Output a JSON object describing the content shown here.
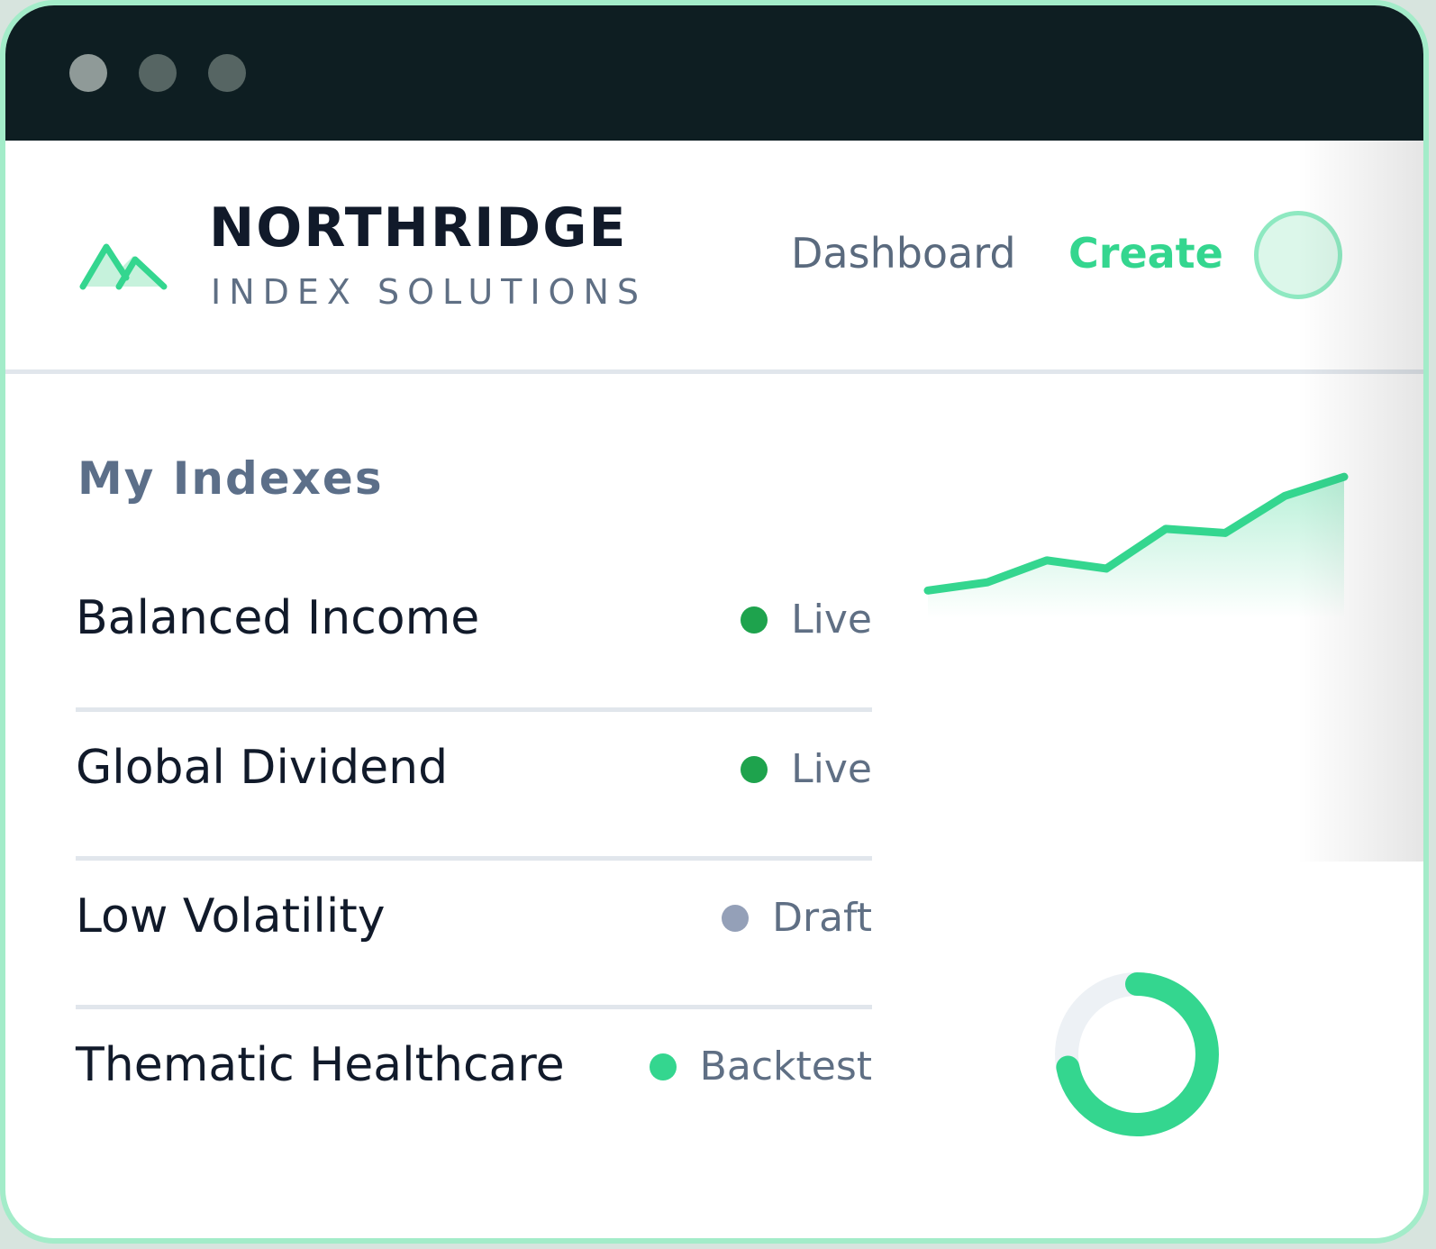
{
  "window": {
    "controls": [
      "close",
      "minimize",
      "maximize"
    ]
  },
  "header": {
    "brand_name": "NORTHRIDGE",
    "brand_subtitle": "INDEX SOLUTIONS",
    "logo_icon": "mountain-icon",
    "nav": {
      "dashboard": "Dashboard",
      "create": "Create"
    },
    "accent_color": "#34d68f"
  },
  "main": {
    "section_title": "My Indexes",
    "indexes": [
      {
        "name": "Balanced Income",
        "status": "Live",
        "status_color": "#1ea34d"
      },
      {
        "name": "Global Dividend",
        "status": "Live",
        "status_color": "#1ea34d"
      },
      {
        "name": "Low Volatility",
        "status": "Draft",
        "status_color": "#94a0b8"
      },
      {
        "name": "Thematic Healthcare",
        "status": "Backtest",
        "status_color": "#34d68f"
      }
    ]
  },
  "chart_data": [
    {
      "type": "area",
      "x": [
        0,
        1,
        2,
        3,
        4,
        5,
        6,
        7
      ],
      "values": [
        11,
        17,
        33,
        27,
        56,
        53,
        80,
        94
      ],
      "ylim": [
        0,
        100
      ],
      "color": "#34d68f",
      "grid": false,
      "title": "",
      "xlabel": "",
      "ylabel": ""
    },
    {
      "type": "pie",
      "style": "donut",
      "values": [
        72,
        28
      ],
      "colors": [
        "#34d68f",
        "#edf1f5"
      ],
      "title": ""
    }
  ]
}
